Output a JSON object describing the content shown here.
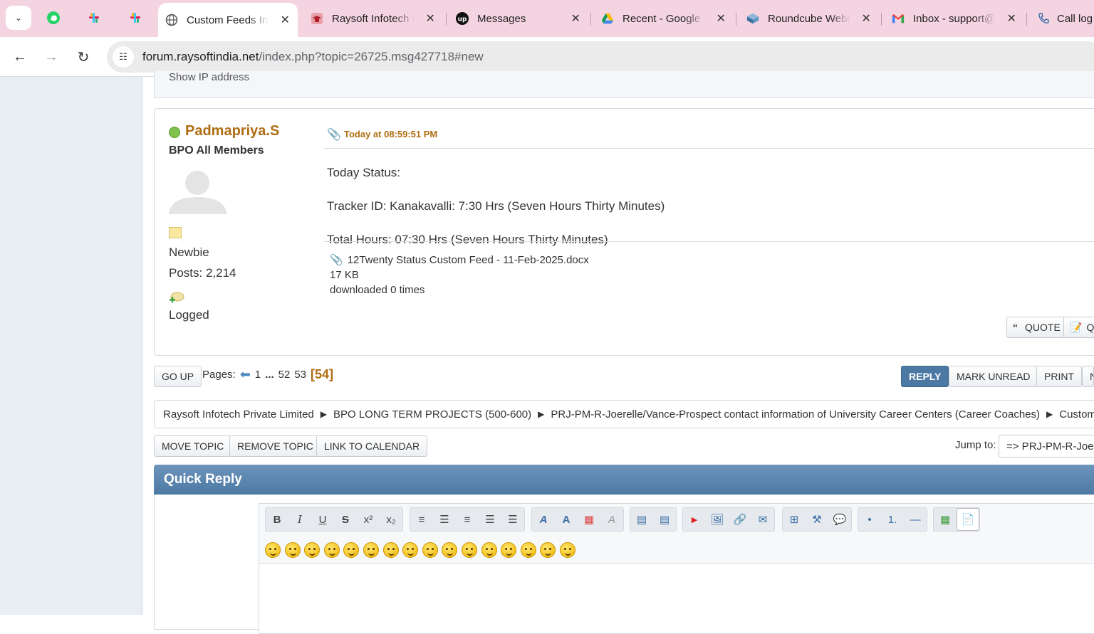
{
  "browser": {
    "tabs": [
      {
        "title": "Custom Feeds Ind",
        "active": true
      },
      {
        "title": "Raysoft Infotech P"
      },
      {
        "title": "Messages"
      },
      {
        "title": "Recent - Google D"
      },
      {
        "title": "Roundcube Webm"
      },
      {
        "title": "Inbox - support@r"
      },
      {
        "title": "Call log"
      }
    ],
    "url_host": "forum.raysoftindia.net",
    "url_path": "/index.php?topic=26725.msg427718#new"
  },
  "prev_post": {
    "show_ip": "Show IP address"
  },
  "post": {
    "username": "Padmapriya.S",
    "membergroup": "BPO All Members",
    "rank": "Newbie",
    "posts": "Posts: 2,214",
    "logged": "Logged",
    "time": "Today at 08:59:51 PM",
    "body": [
      "Today Status:",
      "Tracker ID: Kanakavalli: 7:30 Hrs (Seven Hours Thirty Minutes)",
      "Total Hours: 07:30 Hrs (Seven Hours Thirty Minutes)"
    ],
    "attachment": {
      "name": "12Twenty Status Custom Feed - 11-Feb-2025.docx",
      "size": "17 KB",
      "downloads": "downloaded 0 times"
    },
    "quote_label": "QUOTE",
    "quick_label": "Q"
  },
  "pagination": {
    "go_up": "GO UP",
    "label": "Pages:",
    "first": "1",
    "ellipsis": "...",
    "p52": "52",
    "p53": "53",
    "current": "[54]"
  },
  "topic_buttons": {
    "reply": "REPLY",
    "mark_unread": "MARK UNREAD",
    "print": "PRINT",
    "next": "N"
  },
  "linktree": [
    "Raysoft Infotech Private Limited",
    "BPO LONG TERM PROJECTS (500-600)",
    "PRJ-PM-R-Joerelle/Vance-Prospect contact information of University Career Centers (Career Coaches)",
    "Custom Feeds"
  ],
  "mod_buttons": {
    "move": "MOVE TOPIC",
    "remove": "REMOVE TOPIC",
    "calendar": "LINK TO CALENDAR"
  },
  "jump_to": {
    "label": "Jump to:",
    "value": "=> PRJ-PM-R-Joerelle"
  },
  "quick_reply": {
    "title": "Quick Reply"
  },
  "colors": {
    "accent": "#4c79a4",
    "username": "#b06d12",
    "tabbar": "#f5d4e2"
  }
}
